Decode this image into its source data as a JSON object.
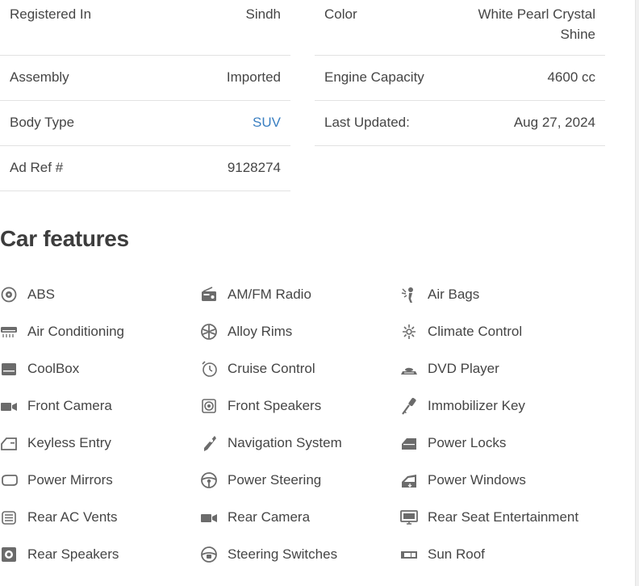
{
  "specs": {
    "left": [
      {
        "label": "Registered In",
        "value": "Sindh"
      },
      {
        "label": "Assembly",
        "value": "Imported"
      },
      {
        "label": "Body Type",
        "value": "SUV"
      },
      {
        "label": "Ad Ref #",
        "value": "9128274"
      }
    ],
    "right": [
      {
        "label": "Color",
        "value": "White Pearl Crystal Shine"
      },
      {
        "label": "Engine Capacity",
        "value": "4600 cc"
      },
      {
        "label": "Last Updated:",
        "value": "Aug 27, 2024"
      }
    ]
  },
  "features": {
    "title": "Car features",
    "items": [
      {
        "label": "ABS",
        "icon": "abs-icon"
      },
      {
        "label": "AM/FM Radio",
        "icon": "radio-icon"
      },
      {
        "label": "Air Bags",
        "icon": "airbag-icon"
      },
      {
        "label": "Air Conditioning",
        "icon": "air-conditioning-icon"
      },
      {
        "label": "Alloy Rims",
        "icon": "alloy-rim-icon"
      },
      {
        "label": "Climate Control",
        "icon": "climate-control-icon"
      },
      {
        "label": "CoolBox",
        "icon": "coolbox-icon"
      },
      {
        "label": "Cruise Control",
        "icon": "cruise-control-icon"
      },
      {
        "label": "DVD Player",
        "icon": "dvd-player-icon"
      },
      {
        "label": "Front Camera",
        "icon": "camera-icon"
      },
      {
        "label": "Front Speakers",
        "icon": "speaker-icon"
      },
      {
        "label": "Immobilizer Key",
        "icon": "key-icon"
      },
      {
        "label": "Keyless Entry",
        "icon": "car-door-icon"
      },
      {
        "label": "Navigation System",
        "icon": "navigation-icon"
      },
      {
        "label": "Power Locks",
        "icon": "power-lock-icon"
      },
      {
        "label": "Power Mirrors",
        "icon": "mirror-icon"
      },
      {
        "label": "Power Steering",
        "icon": "steering-wheel-icon"
      },
      {
        "label": "Power Windows",
        "icon": "power-window-icon"
      },
      {
        "label": "Rear AC Vents",
        "icon": "ac-vent-icon"
      },
      {
        "label": "Rear Camera",
        "icon": "camera-icon"
      },
      {
        "label": "Rear Seat Entertainment",
        "icon": "entertainment-screen-icon"
      },
      {
        "label": "Rear Speakers",
        "icon": "speaker-box-icon"
      },
      {
        "label": "Steering Switches",
        "icon": "steering-switch-icon"
      },
      {
        "label": "Sun Roof",
        "icon": "sunroof-icon"
      }
    ]
  },
  "colors": {
    "text": "#454545",
    "link": "#3a7fc1",
    "icon": "#6b6b6b",
    "divider": "#e2e2e2"
  }
}
